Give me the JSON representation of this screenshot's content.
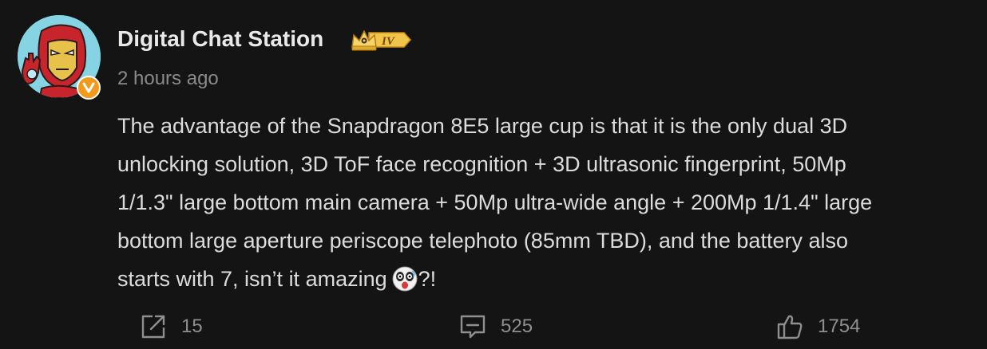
{
  "post": {
    "author": {
      "name": "Digital Chat Station",
      "level_badge": "IV",
      "avatar_icon": "ironman-avatar-icon",
      "verified_badge": "V"
    },
    "timestamp": "2 hours ago",
    "content": {
      "lines": [
        "The advantage of the Snapdragon 8E5 large cup is that it is the only dual 3D",
        "unlocking solution, 3D ToF face recognition + 3D ultrasonic fingerprint, 50Mp",
        "1/1.3\" large bottom main camera + 50Mp ultra-wide angle + 200Mp 1/1.4\" large",
        "bottom large aperture periscope telephoto (85mm TBD), and the battery also",
        "starts with 7, isn’t it amazing"
      ],
      "line_end": "?!",
      "emoji_icon": "shocked-panda-emoji-icon"
    },
    "actions": {
      "repost": {
        "icon": "share-icon",
        "count": "15"
      },
      "comment": {
        "icon": "comment-icon",
        "count": "525"
      },
      "like": {
        "icon": "thumbs-up-icon",
        "count": "1754"
      }
    }
  },
  "colors": {
    "background": "#141414",
    "username": "#e9e9e9",
    "body_text": "#dcdcdc",
    "muted": "#8a8a8a",
    "badge_orange": "#f39a1c",
    "avatar_bg": "#86d3e3"
  }
}
